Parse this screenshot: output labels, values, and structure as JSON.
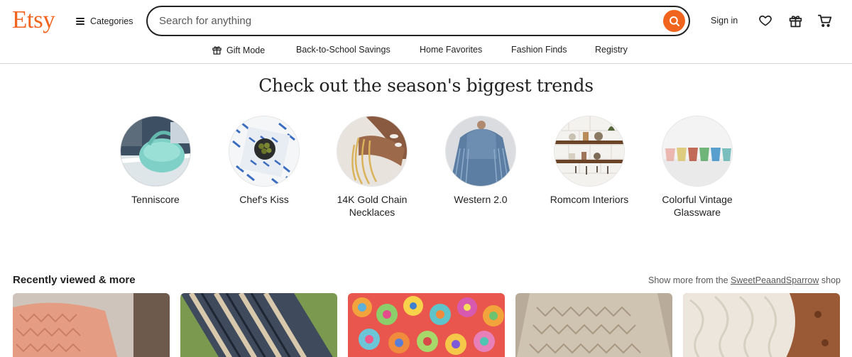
{
  "header": {
    "logo": "Etsy",
    "categories_label": "Categories",
    "search_placeholder": "Search for anything",
    "sign_in_label": "Sign in"
  },
  "subnav": {
    "items": [
      "Gift Mode",
      "Back-to-School Savings",
      "Home Favorites",
      "Fashion Finds",
      "Registry"
    ]
  },
  "trends": {
    "title": "Check out the season's biggest trends",
    "items": [
      {
        "label": "Tenniscore"
      },
      {
        "label": "Chef's Kiss"
      },
      {
        "label": "14K Gold Chain Necklaces"
      },
      {
        "label": "Western 2.0"
      },
      {
        "label": "Romcom Interiors"
      },
      {
        "label": "Colorful Vintage Glassware"
      }
    ]
  },
  "recently_viewed": {
    "title": "Recently viewed & more",
    "show_more_prefix": "Show more from the ",
    "shop_name": "SweetPeaandSparrow",
    "show_more_suffix": " shop"
  },
  "colors": {
    "brand": "#f1641e",
    "text": "#222222",
    "muted": "#595959"
  },
  "icons": {
    "search": "search-icon",
    "favorites": "heart-icon",
    "gift": "gift-icon",
    "cart": "cart-icon"
  }
}
